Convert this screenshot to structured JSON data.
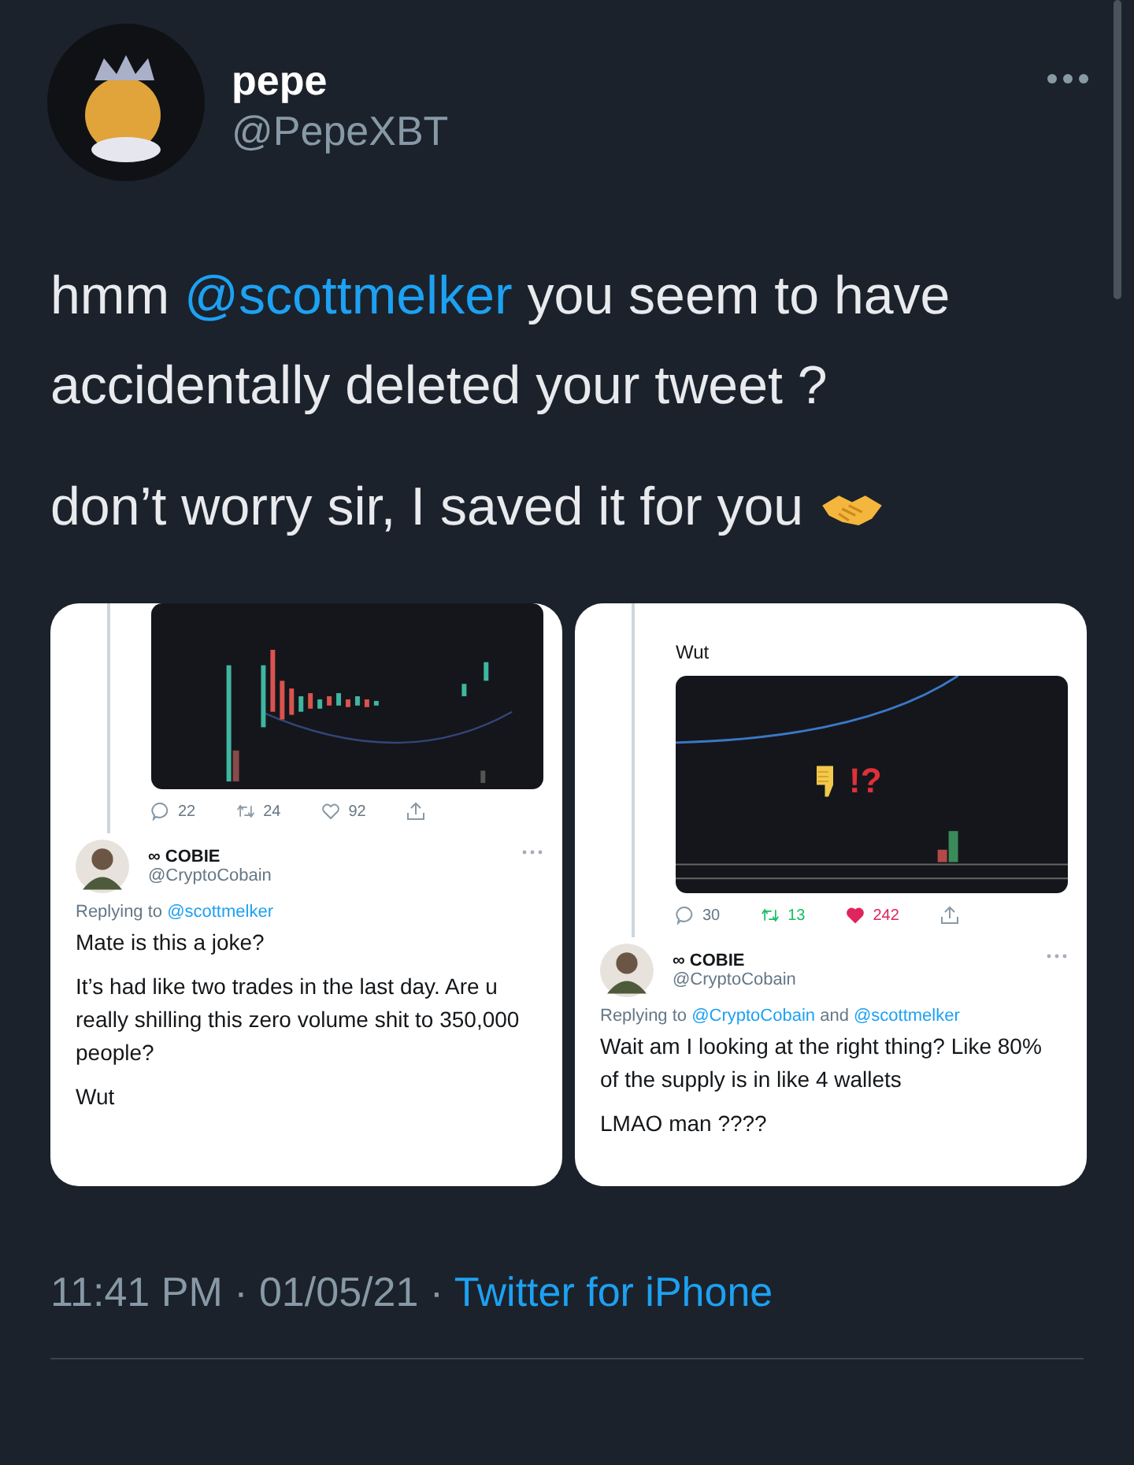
{
  "author": {
    "name": "pepe",
    "handle": "@PepeXBT"
  },
  "paragraphs": [
    [
      {
        "kind": "plain",
        "text": "hmm "
      },
      {
        "kind": "mention",
        "text": "@scottmelker"
      },
      {
        "kind": "plain",
        "text": " you seem to have accidentally deleted your tweet ?"
      }
    ],
    [
      {
        "kind": "plain",
        "text": "don’t worry sir, I saved it for you "
      },
      {
        "kind": "handshake"
      }
    ]
  ],
  "images": [
    {
      "stats": {
        "reply_count": "22",
        "retweet_count": "24",
        "retweeted": false,
        "like_count": "92",
        "liked": false
      },
      "reply": {
        "name": "∞ COBIE",
        "handle": "@CryptoCobain",
        "replying": [
          {
            "kind": "plain",
            "text": "Replying to "
          },
          {
            "kind": "mention",
            "text": "@scottmelker"
          }
        ],
        "body": [
          "Mate is this a joke?",
          "It’s had like two trades in the last day. Are u really shilling this zero volume shit to 350,000 people?",
          "Wut"
        ]
      }
    },
    {
      "above_text": [
        "Wut"
      ],
      "chart_mark": "!?",
      "stats": {
        "reply_count": "30",
        "retweet_count": "13",
        "retweeted": true,
        "like_count": "242",
        "liked": true
      },
      "reply": {
        "name": "∞ COBIE",
        "handle": "@CryptoCobain",
        "replying": [
          {
            "kind": "plain",
            "text": "Replying to "
          },
          {
            "kind": "mention",
            "text": "@CryptoCobain"
          },
          {
            "kind": "plain",
            "text": " and "
          },
          {
            "kind": "mention",
            "text": "@scottmelker"
          }
        ],
        "body": [
          "Wait am I looking at the right thing? Like 80% of the supply is in like 4 wallets",
          "LMAO man ????"
        ]
      }
    }
  ],
  "meta": {
    "time": "11:41 PM",
    "separator": "·",
    "date": "01/05/21",
    "source": "Twitter for iPhone"
  }
}
